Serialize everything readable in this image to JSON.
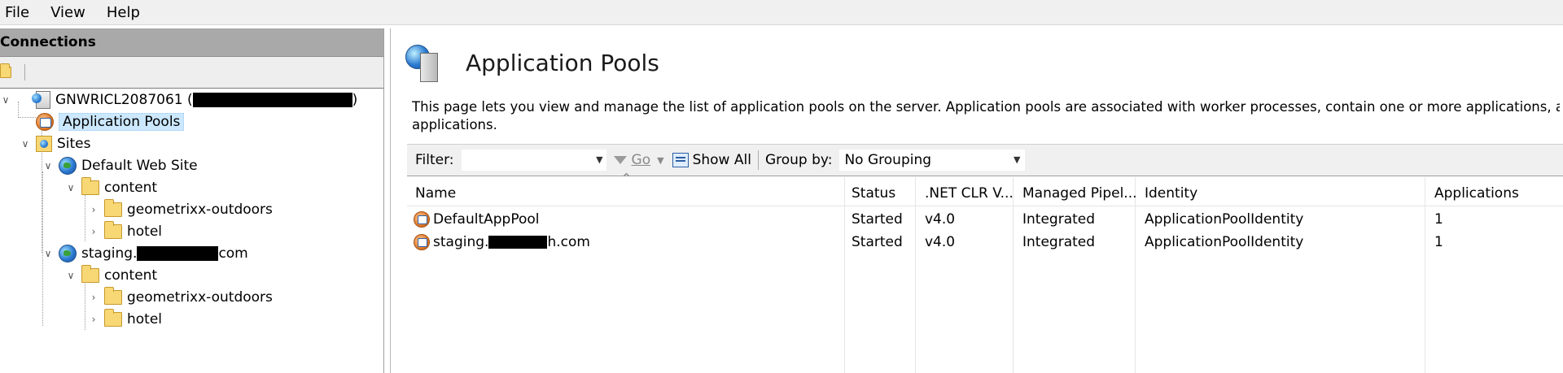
{
  "menu": {
    "file": "File",
    "view": "View",
    "help": "Help"
  },
  "connections": {
    "title": "Connections",
    "tree": {
      "server": "GNWRICL2087061 (",
      "server_close": ")",
      "app_pools": "Application Pools",
      "sites": "Sites",
      "default_site": "Default Web Site",
      "content1": "content",
      "geo1": "geometrixx-outdoors",
      "hotel1": "hotel",
      "staging_prefix": "staging.",
      "staging_suffix": "com",
      "content2": "content",
      "geo2": "geometrixx-outdoors",
      "hotel2": "hotel"
    }
  },
  "main": {
    "title": "Application Pools",
    "description": "This page lets you view and manage the list of application pools on the server. Application pools are associated with worker processes, contain one or more applications, and provic",
    "description2": "applications.",
    "filter": {
      "label": "Filter:",
      "go": "Go",
      "show_all": "Show All",
      "group_by_label": "Group by:",
      "group_by_value": "No Grouping"
    },
    "table": {
      "columns": [
        "Name",
        "Status",
        ".NET CLR V...",
        "Managed Pipel...",
        "Identity",
        "Applications"
      ],
      "rows": [
        {
          "name": "DefaultAppPool",
          "status": "Started",
          "clr": "v4.0",
          "pipeline": "Integrated",
          "identity": "ApplicationPoolIdentity",
          "apps": "1"
        },
        {
          "name_prefix": "staging.",
          "name_suffix": "h.com",
          "status": "Started",
          "clr": "v4.0",
          "pipeline": "Integrated",
          "identity": "ApplicationPoolIdentity",
          "apps": "1"
        }
      ]
    }
  },
  "colors": {
    "selection": "#cce8ff",
    "panel_header": "#a9a9a9",
    "toolbar": "#f0f0f0"
  },
  "icons": [
    "server-icon",
    "app-pool-icon",
    "sites-icon",
    "globe-icon",
    "folder-icon",
    "funnel-icon",
    "show-all-icon"
  ]
}
